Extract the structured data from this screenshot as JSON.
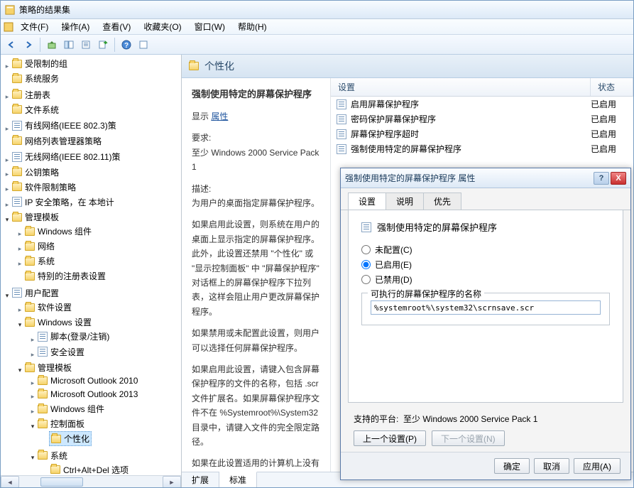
{
  "title": "策略的结果集",
  "menu": {
    "file": "文件(F)",
    "action": "操作(A)",
    "view": "查看(V)",
    "favorites": "收藏夹(O)",
    "window": "窗口(W)",
    "help": "帮助(H)"
  },
  "tree": {
    "n0": "受限制的组",
    "n1": "系统服务",
    "n2": "注册表",
    "n3": "文件系统",
    "n4": "有线网络(IEEE 802.3)策",
    "n5": "网络列表管理器策略",
    "n6": "无线网络(IEEE 802.11)策",
    "n7": "公钥策略",
    "n8": "软件限制策略",
    "n9": "IP 安全策略，在 本地计",
    "g1": "管理模板",
    "g1a": "Windows 组件",
    "g1b": "网络",
    "g1c": "系统",
    "g1d": "特别的注册表设置",
    "g2": "用户配置",
    "g2a": "软件设置",
    "g2b": "Windows 设置",
    "g2b1": "脚本(登录/注销)",
    "g2b2": "安全设置",
    "g2c": "管理模板",
    "g2c1": "Microsoft Outlook 2010",
    "g2c2": "Microsoft Outlook 2013",
    "g2c3": "Windows 组件",
    "g2c4": "控制面板",
    "g2c4a": "个性化",
    "g2c5": "系统",
    "g2c5a": "Ctrl+Alt+Del 选项"
  },
  "content": {
    "header": "个性化",
    "setting_title": "强制使用特定的屏幕保护程序",
    "display_label": "显示",
    "properties_link": "属性",
    "req_label": "要求:",
    "req_text": "至少 Windows 2000 Service Pack 1",
    "desc_label": "描述:",
    "desc_p1": "为用户的桌面指定屏幕保护程序。",
    "desc_p2": "如果启用此设置，则系统在用户的桌面上显示指定的屏幕保护程序。此外，此设置还禁用 \"个性化\" 或 \"显示控制面板\" 中 \"屏幕保护程序\" 对话框上的屏幕保护程序下拉列表，这样会阻止用户更改屏幕保护程序。",
    "desc_p3": "如果禁用或未配置此设置，则用户可以选择任何屏幕保护程序。",
    "desc_p4": "如果启用此设置，请键入包含屏幕保护程序的文件的名称，包括 .scr 文件扩展名。如果屏幕保护程序文件不在 %Systemroot%\\System32 目录中，请键入文件的完全限定路径。",
    "desc_p5": "如果在此设置适用的计算机上没有安装指定的屏幕保护程序，则忽略",
    "listhead": {
      "c1": "设置",
      "c2": "状态"
    },
    "rows": [
      {
        "t": "启用屏幕保护程序",
        "s": "已启用"
      },
      {
        "t": "密码保护屏幕保护程序",
        "s": "已启用"
      },
      {
        "t": "屏幕保护程序超时",
        "s": "已启用"
      },
      {
        "t": "强制使用特定的屏幕保护程序",
        "s": "已启用"
      }
    ],
    "tabs": {
      "ext": "扩展",
      "std": "标准"
    }
  },
  "dialog": {
    "title": "强制使用特定的屏幕保护程序 属性",
    "tabs": {
      "setting": "设置",
      "explain": "说明",
      "precedence": "优先"
    },
    "header": "强制使用特定的屏幕保护程序",
    "opt_unconfigured": "未配置(C)",
    "opt_enabled": "已启用(E)",
    "opt_disabled": "已禁用(D)",
    "group_label": "可执行的屏幕保护程序的名称",
    "input_value": "%systemroot%\\system32\\scrnsave.scr",
    "support_label": "支持的平台:",
    "support_text": "至少 Windows 2000 Service Pack 1",
    "prev": "上一个设置(P)",
    "next": "下一个设置(N)",
    "ok": "确定",
    "cancel": "取消",
    "apply": "应用(A)"
  }
}
